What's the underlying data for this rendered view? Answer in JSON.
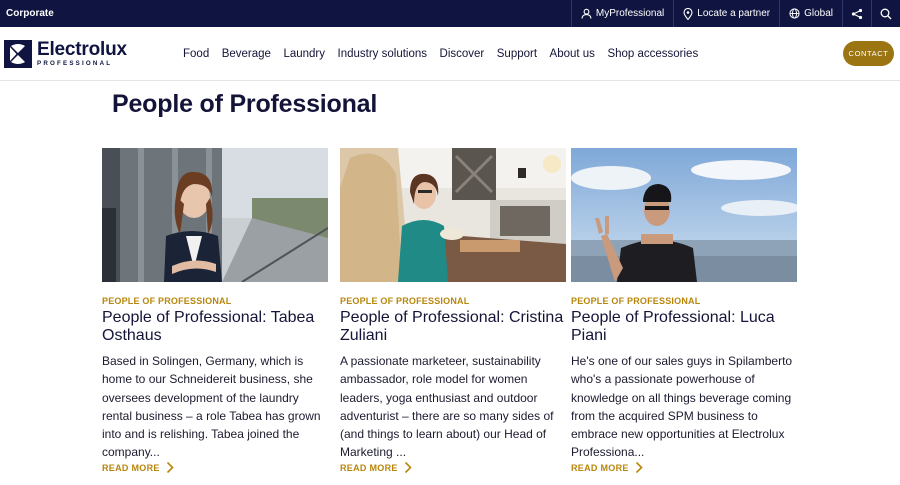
{
  "topbar": {
    "corporate_label": "Corporate",
    "my_professional": "MyProfessional",
    "locate_partner": "Locate a partner",
    "region": "Global"
  },
  "brand": {
    "wordmark": "Electrolux",
    "sub": "PROFESSIONAL"
  },
  "nav": {
    "items": [
      "Food",
      "Beverage",
      "Laundry",
      "Industry solutions",
      "Discover",
      "Support",
      "About us",
      "Shop accessories"
    ],
    "contact_label": "CONTACT"
  },
  "page": {
    "title": "People of Professional"
  },
  "cards": [
    {
      "eyebrow": "PEOPLE OF PROFESSIONAL",
      "title": "People of Professional: Tabea Osthaus",
      "description": "Based in Solingen, Germany, which is home to our Schneidereit business, she oversees development of the laundry rental business – a role Tabea has grown into and is relishing. Tabea joined the company...",
      "read_more": "READ MORE"
    },
    {
      "eyebrow": "PEOPLE OF PROFESSIONAL",
      "title": "People of Professional: Cristina Zuliani",
      "description": "A passionate marketeer, sustainability ambassador, role model for women leaders, yoga enthusiast and outdoor adventurist – there are so many sides of (and things to learn about) our Head of Marketing ...",
      "read_more": "READ MORE"
    },
    {
      "eyebrow": "PEOPLE OF PROFESSIONAL",
      "title": "People of Professional: Luca Piani",
      "description": "He's one of our sales guys in Spilamberto who's a passionate powerhouse of knowledge on all things beverage coming from the acquired SPM business to embrace new opportunities at Electrolux Professiona...",
      "read_more": "READ MORE"
    }
  ],
  "colors": {
    "navy": "#0f1440",
    "gold": "#b8860b",
    "contact_bg": "#9b7512"
  }
}
